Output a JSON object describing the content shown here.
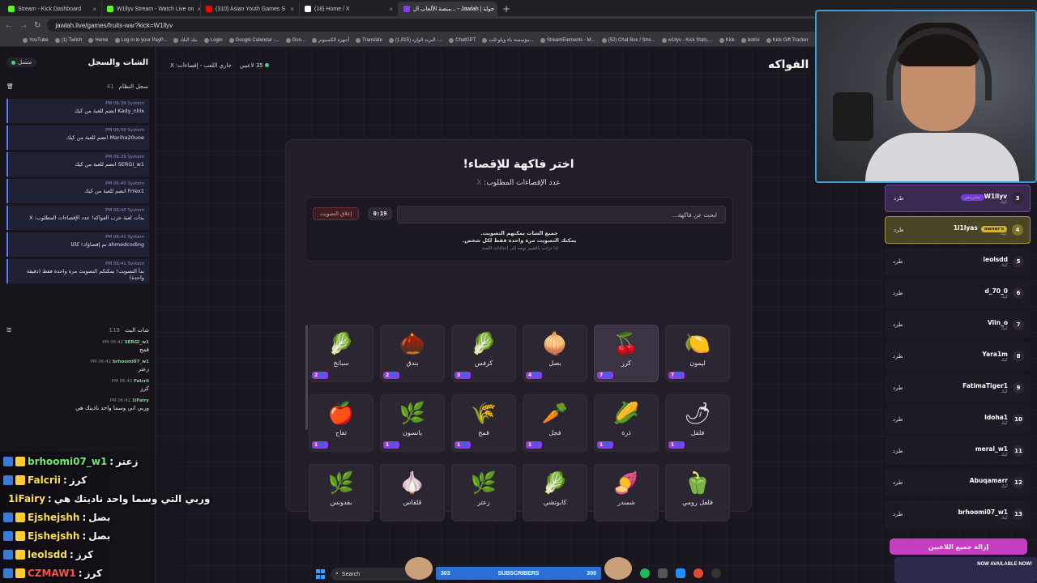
{
  "browser": {
    "tabs": [
      {
        "title": "Stream - Kick Dashboard",
        "color": "#53fc18"
      },
      {
        "title": "W1llyv Stream - Watch Live on",
        "color": "#53fc18"
      },
      {
        "title": "(310) Asian Youth Games S",
        "color": "#ff0000"
      },
      {
        "title": "(18) Home / X",
        "color": "#ffffff"
      },
      {
        "title": "منصة الألعاب ال... - Jawlah | جولة",
        "color": "#8a3df0",
        "active": true
      }
    ],
    "new_tab": "+",
    "url": "jawlah.live/games/fruits-war?kick=W1llyv",
    "bookmarks": [
      "YouTube",
      "(1) Twitch",
      "Home",
      "Log in to your PayP...",
      "بنك البلاد",
      "Login",
      "Google Calendar -...",
      "Goo...",
      "أجهزة الكمبيوتر",
      "Translate",
      "(1,815) البريد الوارد -...",
      "ChatGPT",
      "مؤسسة باء ويلو للت...",
      "StreamElements - M...",
      "(52) Chat Box / Stre...",
      "w1llyv - Kick Stats,...",
      "Kick",
      "botrix",
      "Kick Gift Tracker"
    ]
  },
  "chat_panel": {
    "title": "الشات والسجل",
    "status": "متصل",
    "system_log_title": "سجل النظام",
    "system_log_count": "41",
    "system_messages": [
      {
        "time": "PM 06:39",
        "user": "System",
        "text": "Kady_nlilx انضم للعبة من كيك"
      },
      {
        "time": "PM 06:39",
        "user": "System",
        "text": "Mariha20uoe انضم للعبة من كيك"
      },
      {
        "time": "PM 06:39",
        "user": "System",
        "text": "SERGI_w1 انضم للعبة من كيك"
      },
      {
        "time": "PM 06:40",
        "user": "System",
        "text": "Frrex1 انضم للعبة من كيك"
      },
      {
        "time": "PM 06:40",
        "user": "System",
        "text": "بدأت لعبة حرب الفواكه! عدد الإقصاءات المطلوب: X"
      },
      {
        "time": "PM 06:41",
        "user": "System",
        "text": "ahmedcoding تم إقصاؤك! كاكا"
      },
      {
        "time": "PM 06:41",
        "user": "System",
        "text": "بدأ التصويت! يمكنكم التصويت مرة واحدة فقط (دقيقة واحدة)"
      }
    ],
    "live_chat_title": "شات البث",
    "live_chat_count": "119",
    "live_messages": [
      {
        "time": "PM 06:42",
        "user": "SERGI_w1",
        "text": "قمح"
      },
      {
        "time": "PM 06:42",
        "user": "brhoomi07_w1",
        "text": "زعتر"
      },
      {
        "time": "PM 06:42",
        "user": "Falcrii",
        "text": "كرز"
      },
      {
        "time": "PM 06:42",
        "user": "1iFairy",
        "text": "وربي اني وسما واحد ناديتك هي"
      }
    ]
  },
  "overlay_chat": [
    {
      "user": "brhoomi07_w1",
      "text": "زعتر",
      "color": "#6cf06c"
    },
    {
      "user": "Falcrii",
      "text": "كرز",
      "color": "#ffe04a"
    },
    {
      "user": "1iFairy",
      "text": "وربي التي وسما واحد ناديتك هي",
      "color": "#ffe04a"
    },
    {
      "user": "Ejshejshh",
      "text": "بصل",
      "color": "#ffe04a"
    },
    {
      "user": "Ejshejshh",
      "text": "بصل",
      "color": "#ffe04a"
    },
    {
      "user": "leolsdd",
      "text": "كرز",
      "color": "#ffe04a"
    },
    {
      "user": "CZMAW1",
      "text": "كرز",
      "color": "#ff5050"
    }
  ],
  "topbar": {
    "players": "35 لاعبين",
    "status": "جاري اللعب - إقصاءات: X"
  },
  "game_title": "الفواكه",
  "card": {
    "title": "اختر فاكهة للإقصاء!",
    "subtitle": "عدد الإقصاءات المطلوب:",
    "subtitle_value": "X",
    "close_vote": "إغلاق التصويت",
    "timer": "0:19",
    "search_placeholder": "ابحث عن فاكهة...",
    "note1": "جميع الشات يمكنهم التصويت.",
    "note2": "يمكنك التصويت مرة واحدة فقط لكل شخص.",
    "note3": "إذا ترغب بالتغيير توجه إلى إعدادات اللعبة."
  },
  "fruits": [
    {
      "name": "ليمون",
      "icon": "🍋",
      "count": "7"
    },
    {
      "name": "كرز",
      "icon": "🍒",
      "count": "7",
      "selected": true
    },
    {
      "name": "بصل",
      "icon": "🧅",
      "count": "4"
    },
    {
      "name": "كرفس",
      "icon": "🥬",
      "count": "3"
    },
    {
      "name": "بندق",
      "icon": "🌰",
      "count": "2"
    },
    {
      "name": "سبانخ",
      "icon": "🥬",
      "count": "2"
    },
    {
      "name": "فلفل",
      "icon": "🌶",
      "count": "1"
    },
    {
      "name": "ذرة",
      "icon": "🌽",
      "count": "1"
    },
    {
      "name": "فجل",
      "icon": "🥕",
      "count": "1"
    },
    {
      "name": "قمح",
      "icon": "🌾",
      "count": "1"
    },
    {
      "name": "يانسون",
      "icon": "🌿",
      "count": "1"
    },
    {
      "name": "تفاح",
      "icon": "🍎",
      "count": "1"
    },
    {
      "name": "فلفل رومي",
      "icon": "🫑",
      "count": ""
    },
    {
      "name": "شمندر",
      "icon": "🍠",
      "count": ""
    },
    {
      "name": "كابوتشي",
      "icon": "🥬",
      "count": ""
    },
    {
      "name": "زعتر",
      "icon": "🌿",
      "count": ""
    },
    {
      "name": "قلقاس",
      "icon": "🧄",
      "count": ""
    },
    {
      "name": "بقدونس",
      "icon": "🌿",
      "count": ""
    }
  ],
  "players": [
    {
      "rank": "3",
      "name": "W1llyv",
      "sub": "كيك",
      "tag": "ستريمر",
      "tag_type": "sub",
      "kick": "طرد"
    },
    {
      "rank": "4",
      "name": "1i1lyas",
      "sub": "كيك",
      "tag": "owner's",
      "tag_type": "owner",
      "kick": "طرد"
    },
    {
      "rank": "5",
      "name": "leolsdd",
      "sub": "كيك",
      "kick": "طرد"
    },
    {
      "rank": "6",
      "name": "d_70_0",
      "sub": "كيك",
      "kick": "طرد"
    },
    {
      "rank": "7",
      "name": "Viin_o",
      "sub": "كيك",
      "kick": "طرد"
    },
    {
      "rank": "8",
      "name": "Yara1m",
      "sub": "كيك",
      "kick": "طرد"
    },
    {
      "rank": "9",
      "name": "FatimaTiger1",
      "sub": "كيك",
      "kick": "طرد"
    },
    {
      "rank": "10",
      "name": "Idoha1",
      "sub": "كيك",
      "kick": "طرد"
    },
    {
      "rank": "11",
      "name": "meral_w1",
      "sub": "كيك",
      "kick": "طرد"
    },
    {
      "rank": "12",
      "name": "Abuqamarr",
      "sub": "كيك",
      "kick": "طرد"
    },
    {
      "rank": "13",
      "name": "brhoomi07_w1",
      "sub": "كيك",
      "kick": "طرد"
    }
  ],
  "remove_all": "إزالة جميع اللاعبين",
  "taskbar": {
    "search": "Search",
    "subs_left": "303",
    "subs_label": "SUBSCRIBERS",
    "subs_right": "300"
  },
  "ad_text": "NOW AVAILABLE NOW!"
}
